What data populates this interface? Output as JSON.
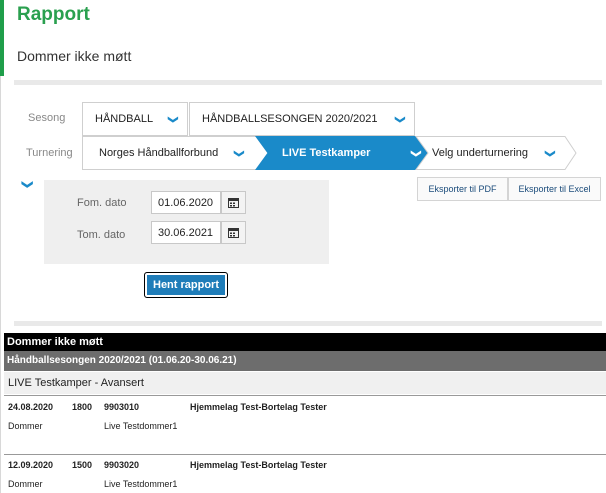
{
  "header": {
    "title": "Rapport",
    "subtitle": "Dommer ikke møtt"
  },
  "filters": {
    "sesong_label": "Sesong",
    "sport": "HÅNDBALL",
    "season": "HÅNDBALLSESONGEN 2020/2021",
    "turnering_label": "Turnering",
    "crumbs": [
      "Norges Håndballforbund",
      "LIVE Testkamper",
      "Velg underturnering"
    ],
    "from_label": "Fom. dato",
    "from_value": "01.06.2020",
    "to_label": "Tom. dato",
    "to_value": "30.06.2021",
    "run_button": "Hent rapport"
  },
  "export": {
    "pdf": "Eksporter til PDF",
    "excel": "Eksporter til Excel"
  },
  "report": {
    "title": "Dommer ikke møtt",
    "season_header": "Håndballsesongen 2020/2021 (01.06.20-30.06.21)",
    "tournament": "LIVE Testkamper - Avansert",
    "matches": [
      {
        "date": "24.08.2020",
        "time": "1800",
        "number": "9903010",
        "teams": "Hjemmelag Test-Bortelag Tester",
        "role": "Dommer",
        "referee": "Live Testdommer1"
      },
      {
        "date": "12.09.2020",
        "time": "1500",
        "number": "9903020",
        "teams": "Hjemmelag Test-Bortelag Tester",
        "role": "Dommer",
        "referee": "Live Testdommer1"
      }
    ]
  },
  "colors": {
    "brand_green": "#2aa04f",
    "accent_blue": "#1a8ac9",
    "active_crumb": "#1a8ac9"
  },
  "icons": {
    "chevron": "chevron-down-icon",
    "calendar": "calendar-icon"
  }
}
